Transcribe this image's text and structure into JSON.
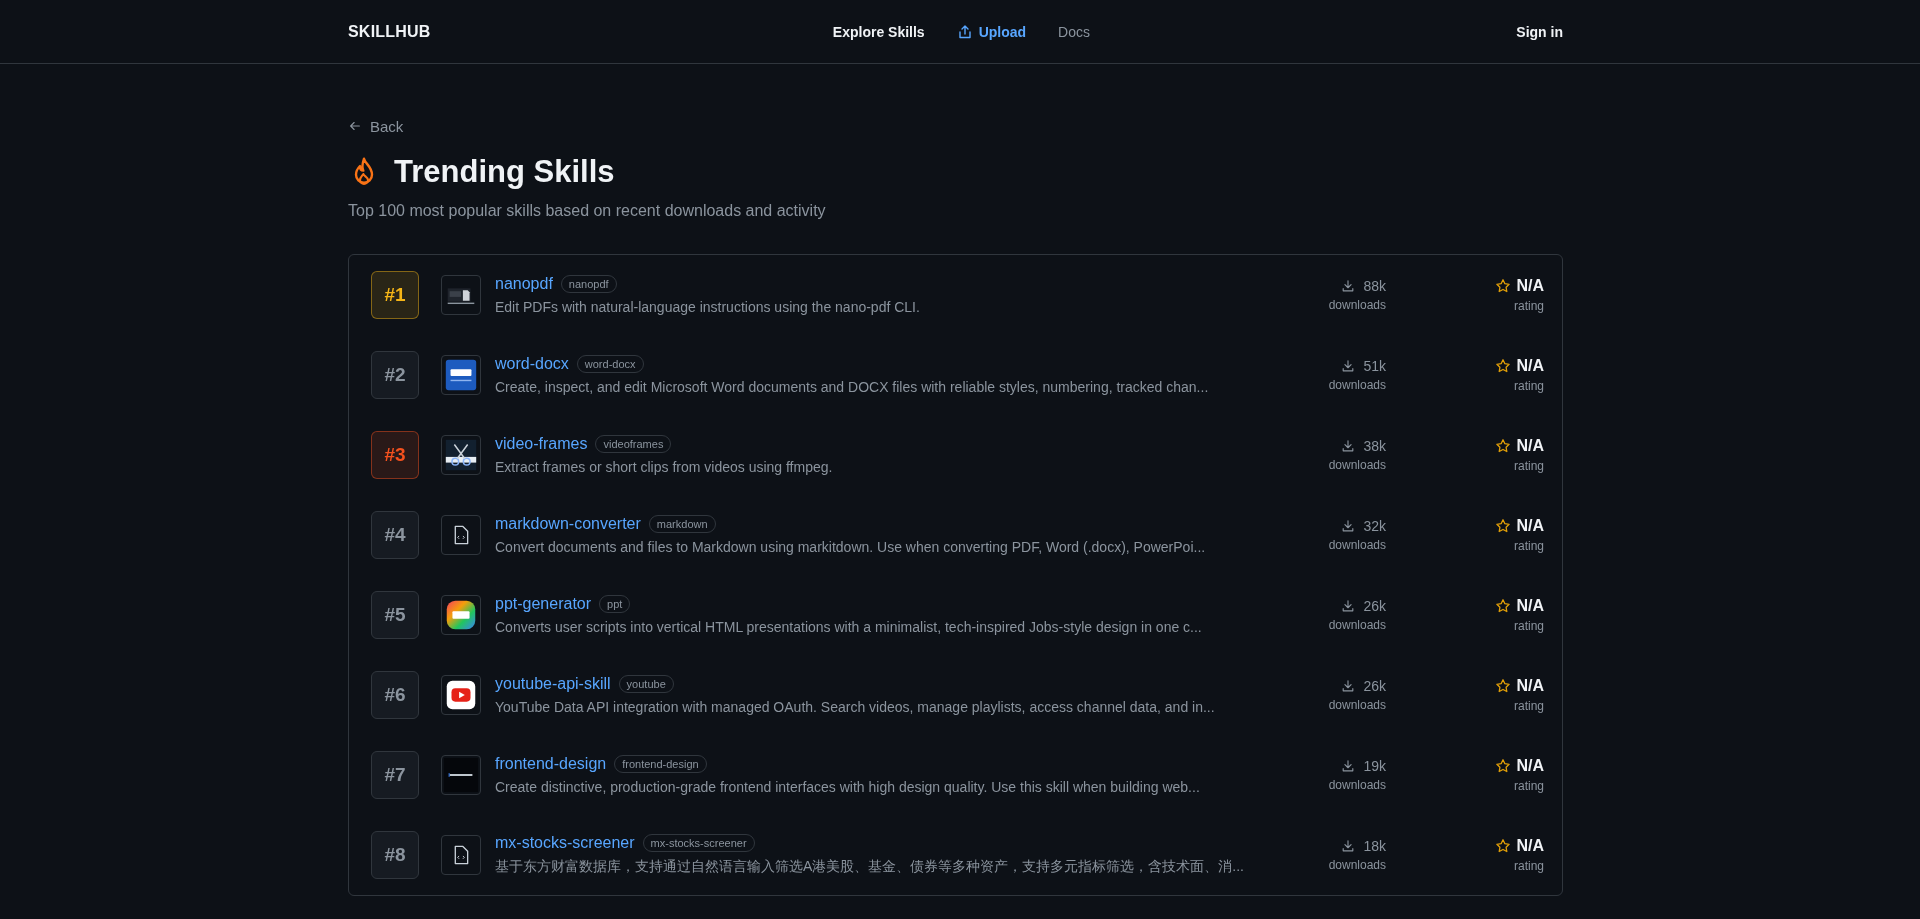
{
  "header": {
    "logo": "SKILLHUB",
    "nav": [
      {
        "label": "Explore Skills",
        "kind": "primary"
      },
      {
        "label": "Upload",
        "kind": "accent"
      },
      {
        "label": "Docs",
        "kind": "muted"
      }
    ],
    "sign_in": "Sign in"
  },
  "back": "Back",
  "title": "Trending Skills",
  "subtitle": "Top 100 most popular skills based on recent downloads and activity",
  "skills": [
    {
      "rank": "#1",
      "color": "#f5b517",
      "kind": "pdf",
      "name": "nanopdf",
      "tag": "nanopdf",
      "description": "Edit PDFs with natural-language instructions using the nano-pdf CLI.",
      "downloads": "88k",
      "downloads_label": "downloads",
      "rating": "N/A",
      "rating_label": "rating"
    },
    {
      "rank": "#2",
      "kind": "word",
      "name": "word-docx",
      "tag": "word-docx",
      "description": "Create, inspect, and edit Microsoft Word documents and DOCX files with reliable styles, numbering, tracked chan...",
      "downloads": "51k",
      "downloads_label": "downloads",
      "rating": "N/A",
      "rating_label": "rating"
    },
    {
      "rank": "#3",
      "color": "#f4511e",
      "kind": "video",
      "name": "video-frames",
      "tag": "videoframes",
      "description": "Extract frames or short clips from videos using ffmpeg.",
      "downloads": "38k",
      "downloads_label": "downloads",
      "rating": "N/A",
      "rating_label": "rating"
    },
    {
      "rank": "#4",
      "kind": "file",
      "name": "markdown-converter",
      "tag": "markdown",
      "description": "Convert documents and files to Markdown using markitdown. Use when converting PDF, Word (.docx), PowerPoi...",
      "downloads": "32k",
      "downloads_label": "downloads",
      "rating": "N/A",
      "rating_label": "rating"
    },
    {
      "rank": "#5",
      "kind": "ppt",
      "name": "ppt-generator",
      "tag": "ppt",
      "description": "Converts user scripts into vertical HTML presentations with a minimalist, tech-inspired Jobs-style design in one c...",
      "downloads": "26k",
      "downloads_label": "downloads",
      "rating": "N/A",
      "rating_label": "rating"
    },
    {
      "rank": "#6",
      "kind": "youtube",
      "name": "youtube-api-skill",
      "tag": "youtube",
      "description": "YouTube Data API integration with managed OAuth. Search videos, manage playlists, access channel data, and in...",
      "downloads": "26k",
      "downloads_label": "downloads",
      "rating": "N/A",
      "rating_label": "rating"
    },
    {
      "rank": "#7",
      "kind": "frontend",
      "name": "frontend-design",
      "tag": "frontend-design",
      "description": "Create distinctive, production-grade frontend interfaces with high design quality. Use this skill when building web...",
      "downloads": "19k",
      "downloads_label": "downloads",
      "rating": "N/A",
      "rating_label": "rating"
    },
    {
      "rank": "#8",
      "kind": "file",
      "name": "mx-stocks-screener",
      "tag": "mx-stocks-screener",
      "description": "基于东方财富数据库，支持通过自然语言输入筛选A港美股、基金、债券等多种资产，支持多元指标筛选，含技术面、消...",
      "downloads": "18k",
      "downloads_label": "downloads",
      "rating": "N/A",
      "rating_label": "rating"
    }
  ]
}
